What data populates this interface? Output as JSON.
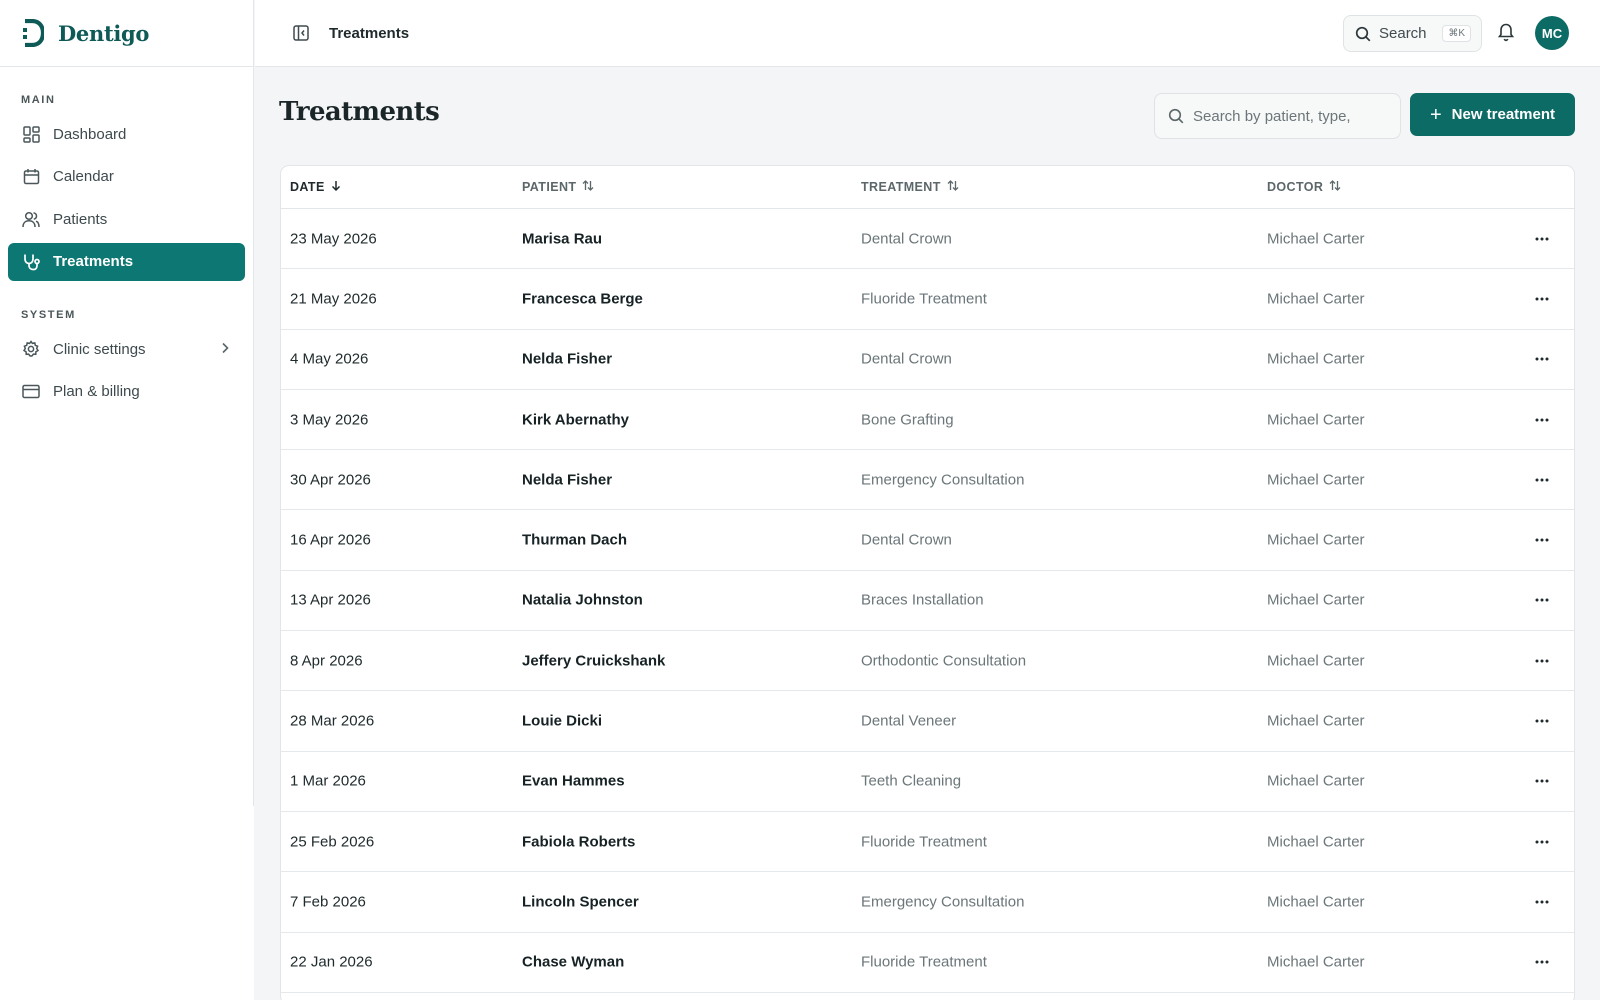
{
  "app": {
    "name": "Dentigo"
  },
  "sidebar": {
    "main_heading": "MAIN",
    "main_items": [
      {
        "label": "Dashboard",
        "icon": "dashboard-icon"
      },
      {
        "label": "Calendar",
        "icon": "calendar-icon"
      },
      {
        "label": "Patients",
        "icon": "users-icon"
      },
      {
        "label": "Treatments",
        "icon": "stethoscope-icon",
        "active": true
      }
    ],
    "system_heading": "SYSTEM",
    "system_items": [
      {
        "label": "Clinic settings",
        "icon": "gear-icon",
        "has_submenu": true
      },
      {
        "label": "Plan & billing",
        "icon": "credit-card-icon"
      }
    ]
  },
  "topbar": {
    "title": "Treatments",
    "search_label": "Search",
    "search_shortcut": "⌘K",
    "avatar_initials": "MC"
  },
  "page": {
    "title": "Treatments",
    "filter_placeholder": "Search by patient, type,",
    "new_button_label": "New treatment"
  },
  "table": {
    "columns": [
      {
        "label": "DATE",
        "sort": "desc"
      },
      {
        "label": "PATIENT",
        "sort": "none"
      },
      {
        "label": "TREATMENT",
        "sort": "none"
      },
      {
        "label": "DOCTOR",
        "sort": "none"
      }
    ],
    "rows": [
      {
        "date": "23 May 2026",
        "patient": "Marisa Rau",
        "treatment": "Dental Crown",
        "doctor": "Michael Carter"
      },
      {
        "date": "21 May 2026",
        "patient": "Francesca Berge",
        "treatment": "Fluoride Treatment",
        "doctor": "Michael Carter"
      },
      {
        "date": "4 May 2026",
        "patient": "Nelda Fisher",
        "treatment": "Dental Crown",
        "doctor": "Michael Carter"
      },
      {
        "date": "3 May 2026",
        "patient": "Kirk Abernathy",
        "treatment": "Bone Grafting",
        "doctor": "Michael Carter"
      },
      {
        "date": "30 Apr 2026",
        "patient": "Nelda Fisher",
        "treatment": "Emergency Consultation",
        "doctor": "Michael Carter"
      },
      {
        "date": "16 Apr 2026",
        "patient": "Thurman Dach",
        "treatment": "Dental Crown",
        "doctor": "Michael Carter"
      },
      {
        "date": "13 Apr 2026",
        "patient": "Natalia Johnston",
        "treatment": "Braces Installation",
        "doctor": "Michael Carter"
      },
      {
        "date": "8 Apr 2026",
        "patient": "Jeffery Cruickshank",
        "treatment": "Orthodontic Consultation",
        "doctor": "Michael Carter"
      },
      {
        "date": "28 Mar 2026",
        "patient": "Louie Dicki",
        "treatment": "Dental Veneer",
        "doctor": "Michael Carter"
      },
      {
        "date": "1 Mar 2026",
        "patient": "Evan Hammes",
        "treatment": "Teeth Cleaning",
        "doctor": "Michael Carter"
      },
      {
        "date": "25 Feb 2026",
        "patient": "Fabiola Roberts",
        "treatment": "Fluoride Treatment",
        "doctor": "Michael Carter"
      },
      {
        "date": "7 Feb 2026",
        "patient": "Lincoln Spencer",
        "treatment": "Emergency Consultation",
        "doctor": "Michael Carter"
      },
      {
        "date": "22 Jan 2026",
        "patient": "Chase Wyman",
        "treatment": "Fluoride Treatment",
        "doctor": "Michael Carter"
      }
    ]
  },
  "colors": {
    "brand": "#0d6b66",
    "active_nav": "#0d7873"
  }
}
